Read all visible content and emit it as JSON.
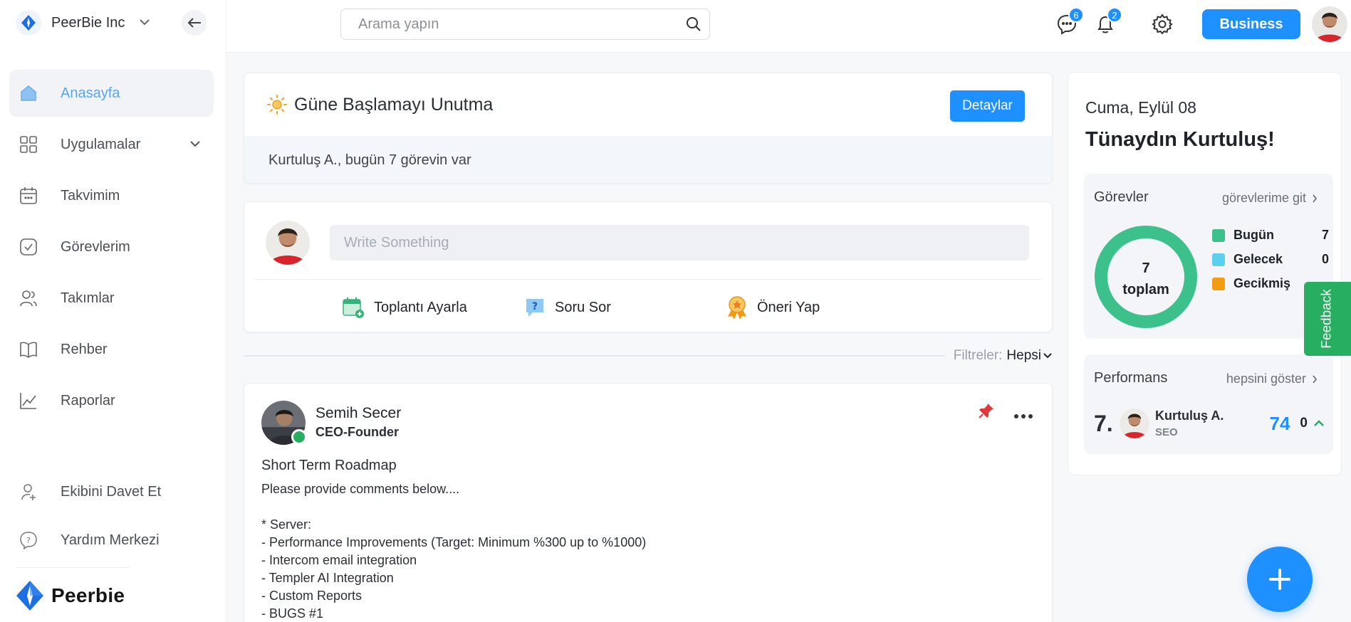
{
  "org": {
    "name": "PeerBie Inc"
  },
  "sidebar": {
    "items": [
      {
        "label": "Anasayfa"
      },
      {
        "label": "Uygulamalar"
      },
      {
        "label": "Takvimim"
      },
      {
        "label": "Görevlerim"
      },
      {
        "label": "Takımlar"
      },
      {
        "label": "Rehber"
      },
      {
        "label": "Raporlar"
      }
    ],
    "bottom": [
      {
        "label": "Ekibini Davet Et"
      },
      {
        "label": "Yardım Merkezi"
      }
    ],
    "brand": "Peerbie"
  },
  "topbar": {
    "search_placeholder": "Arama yapın",
    "messages_badge": "6",
    "notifications_badge": "2",
    "business_label": "Business"
  },
  "reminder": {
    "title": "Güne Başlamayı Unutma",
    "details_label": "Detaylar",
    "body": "Kurtuluş A., bugün 7 görevin var"
  },
  "composer": {
    "placeholder": "Write Something",
    "actions": [
      {
        "label": "Toplantı Ayarla"
      },
      {
        "label": "Soru Sor"
      },
      {
        "label": "Öneri Yap"
      }
    ]
  },
  "filters": {
    "label": "Filtreler:",
    "value": "Hepsi"
  },
  "post": {
    "author": "Semih Secer",
    "role": "CEO-Founder",
    "title": "Short Term Roadmap",
    "body": "Please provide comments below....\n\n* Server:\n- Performance Improvements (Target: Minimum %300 up to %1000)\n- Intercom email integration\n- Templer AI Integration\n- Custom Reports\n- BUGS #1"
  },
  "right": {
    "date": "Cuma, Eylül 08",
    "greeting": "Tünaydın Kurtuluş!",
    "tasks": {
      "title": "Görevler",
      "link": "görevlerime git",
      "total": "7",
      "total_label": "toplam",
      "legend": [
        {
          "name": "Bugün",
          "value": "7",
          "color": "#3cc08c"
        },
        {
          "name": "Gelecek",
          "value": "0",
          "color": "#5bd0f0"
        },
        {
          "name": "Gecikmiş",
          "value": "",
          "color": "#f39c12"
        }
      ]
    },
    "performance": {
      "title": "Performans",
      "link": "hepsini göster",
      "rank": "7.",
      "name": "Kurtuluş A.",
      "role": "SEO",
      "score": "74",
      "delta": "0"
    }
  },
  "feedback_label": "Feedback"
}
